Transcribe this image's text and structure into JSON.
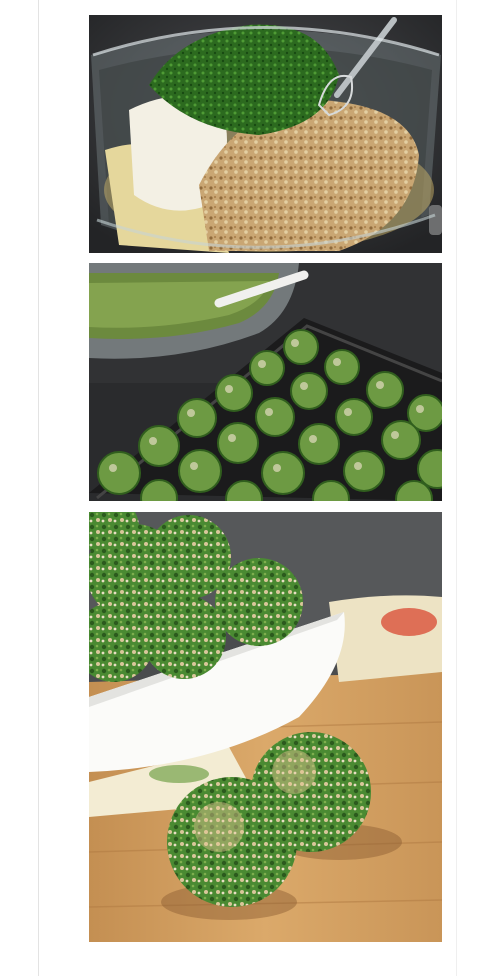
{
  "page": {
    "background": "#ffffff",
    "rule_color": "#e3e3e3"
  },
  "photos": [
    {
      "subject": "mixing-bowl-with-spinach-breadcrumbs-onion-egg",
      "palette": [
        "#3a3b3d",
        "#2f6b22",
        "#c9a977",
        "#f1ecd8"
      ]
    },
    {
      "subject": "baking-sheet-with-raw-spinach-balls",
      "palette": [
        "#2c2c2e",
        "#3f7a2c",
        "#cfc9a6"
      ]
    },
    {
      "subject": "baked-spinach-balls-in-white-bowl-on-wood-board",
      "palette": [
        "#3e7a2c",
        "#f7f7f5",
        "#d8a767"
      ]
    }
  ]
}
